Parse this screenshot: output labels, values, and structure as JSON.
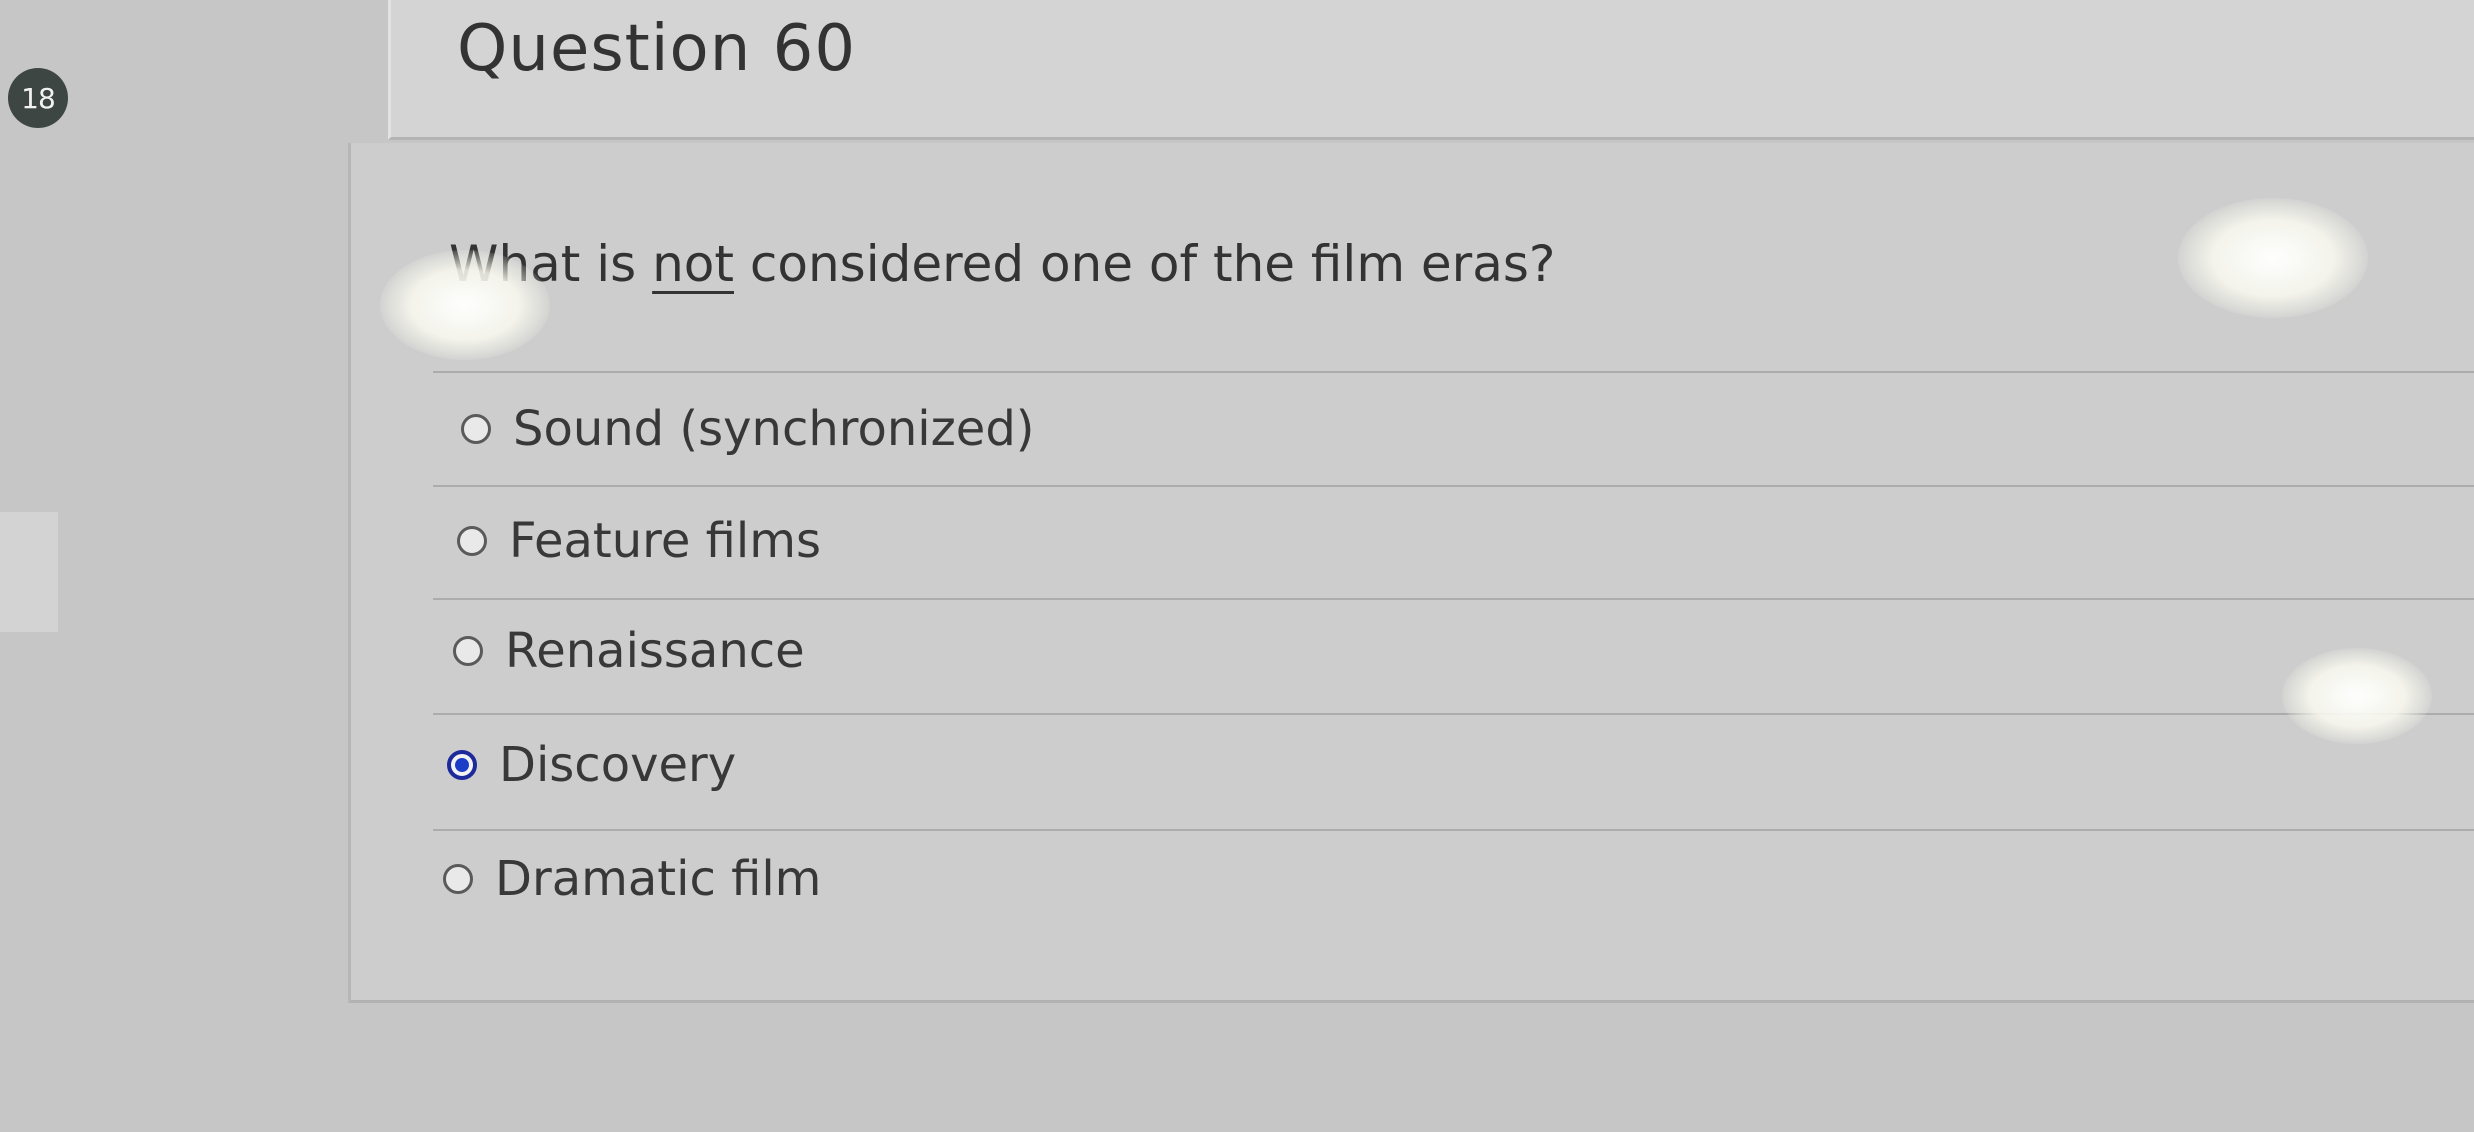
{
  "question_number_badge": "18",
  "header": {
    "title": "Question 60"
  },
  "question": {
    "prefix": "What is ",
    "emphasis": "not",
    "suffix": " considered one of the film eras?"
  },
  "options": [
    {
      "label": "Sound (synchronized)",
      "selected": false
    },
    {
      "label": "Feature films",
      "selected": false
    },
    {
      "label": "Renaissance",
      "selected": false
    },
    {
      "label": "Discovery",
      "selected": true
    },
    {
      "label": "Dramatic film",
      "selected": false
    }
  ],
  "colors": {
    "selected_radio": "#1a3ec8",
    "badge_background": "#3d4642"
  }
}
